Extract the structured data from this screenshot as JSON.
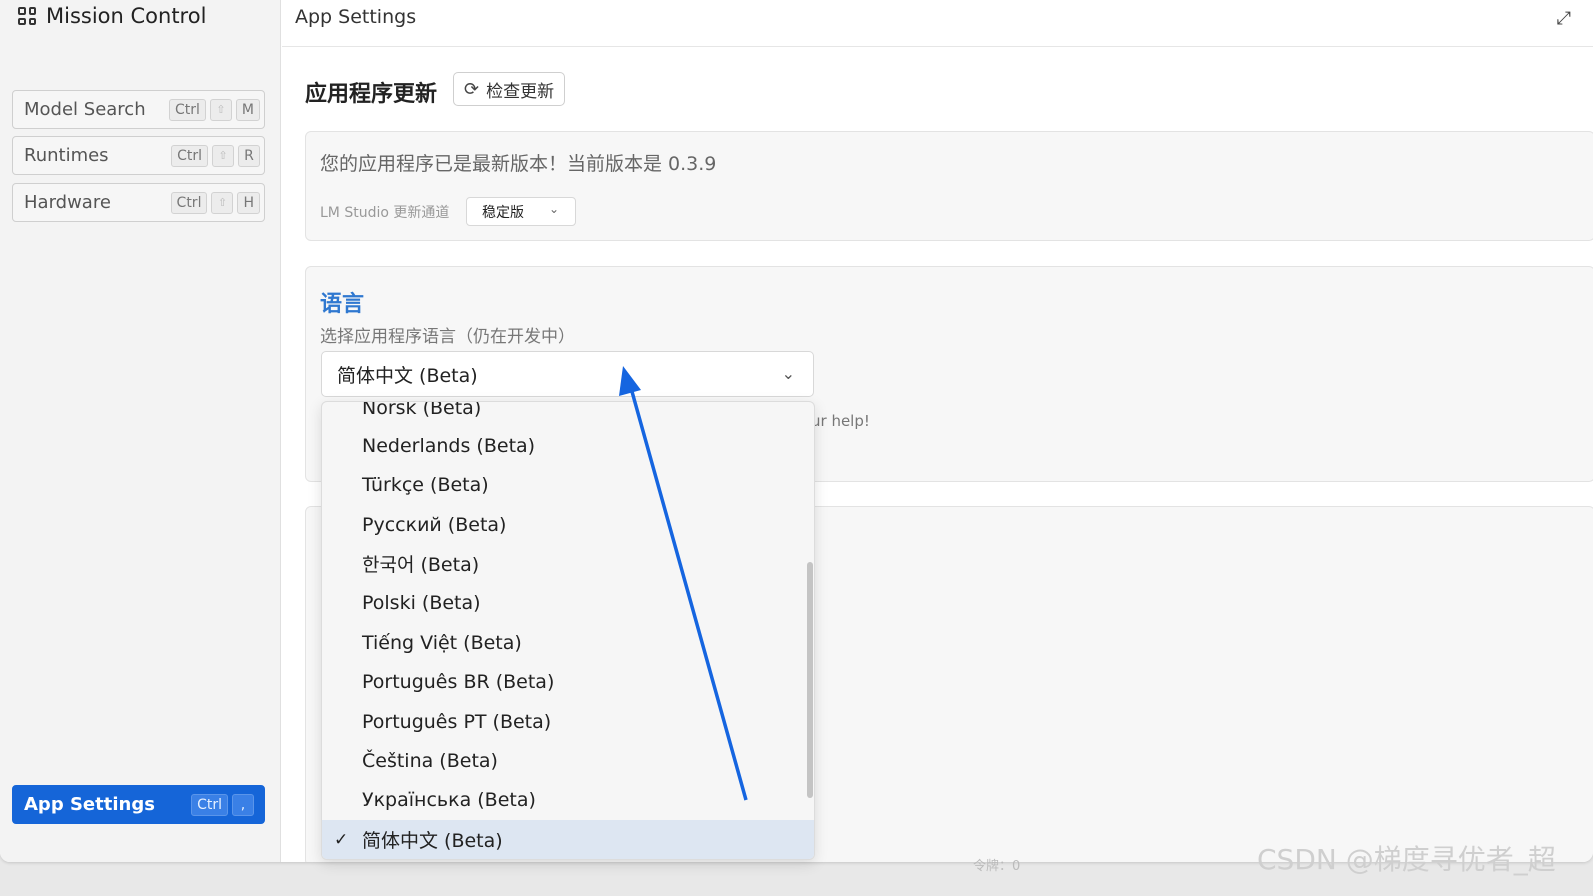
{
  "sidebar": {
    "title": "Mission Control",
    "items": [
      {
        "label": "Model Search",
        "keys": [
          "Ctrl",
          "⇧",
          "M"
        ]
      },
      {
        "label": "Runtimes",
        "keys": [
          "Ctrl",
          "⇧",
          "R"
        ]
      },
      {
        "label": "Hardware",
        "keys": [
          "Ctrl",
          "⇧",
          "H"
        ]
      }
    ],
    "active_item": {
      "label": "App Settings",
      "keys": [
        "Ctrl",
        ","
      ]
    }
  },
  "header": {
    "title": "App Settings",
    "expand_icon": "expand-icon"
  },
  "update_section": {
    "heading": "应用程序更新",
    "check_button": "检查更新",
    "status_message": "您的应用程序已是最新版本！当前版本是 0.3.9",
    "channel_label": "LM Studio 更新通道",
    "channel_value": "稳定版"
  },
  "language_section": {
    "title": "语言",
    "subtitle": "选择应用程序语言（仍在开发中）",
    "selected": "简体中文 (Beta)",
    "help_text": "ur help!"
  },
  "language_dropdown": {
    "options": [
      "Norsk (Beta)",
      "Nederlands (Beta)",
      "Türkçe (Beta)",
      "Русский (Beta)",
      "한국어 (Beta)",
      "Polski (Beta)",
      "Tiếng Việt (Beta)",
      "Português BR (Beta)",
      "Português PT (Beta)",
      "Čeština (Beta)",
      "Українська (Beta)",
      "简体中文 (Beta)"
    ],
    "selected_index": 11
  },
  "footer": {
    "token_label": "令牌：0",
    "watermark": "CSDN @梯度寻优者_超"
  },
  "colors": {
    "accent": "#1565d8",
    "annotation_arrow": "#1565e0",
    "lang_title": "#2f78d0"
  }
}
